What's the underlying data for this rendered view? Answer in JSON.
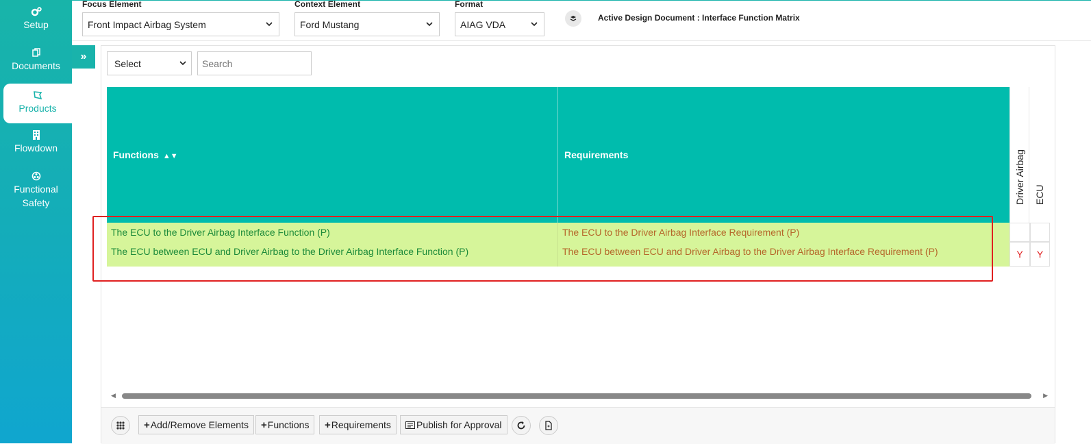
{
  "sidebar": {
    "items": [
      {
        "label": "Setup",
        "icon": "gears-icon"
      },
      {
        "label": "Documents",
        "icon": "copy-icon"
      },
      {
        "label": "Products",
        "icon": "product-icon",
        "active": true
      },
      {
        "label": "Flowdown",
        "icon": "building-icon"
      },
      {
        "label": "Functional Safety",
        "icon": "biohazard-icon"
      }
    ]
  },
  "header": {
    "focus_label": "Focus Element",
    "focus_value": "Front Impact Airbag System",
    "context_label": "Context Element",
    "context_value": "Ford Mustang",
    "format_label": "Format",
    "format_value": "AIAG VDA",
    "active_doc": "Active Design Document : Interface Function Matrix"
  },
  "filter": {
    "select_value": "Select",
    "search_placeholder": "Search"
  },
  "table": {
    "columns": {
      "functions": "Functions",
      "requirements": "Requirements"
    },
    "matrix_columns": [
      "Driver Airbag",
      "ECU"
    ],
    "rows": [
      {
        "function": "The ECU to the Driver Airbag Interface Function (P)",
        "requirement": "The ECU to the Driver Airbag Interface Requirement (P)",
        "marks": [
          "",
          ""
        ]
      },
      {
        "function": "The ECU between ECU and Driver Airbag to the Driver Airbag Interface Function (P)",
        "requirement": "The ECU between ECU and Driver Airbag to the Driver Airbag Interface Requirement (P)",
        "marks": [
          "Y",
          "Y"
        ]
      }
    ]
  },
  "toolbar": {
    "add_remove": "Add/Remove Elements",
    "functions": "Functions",
    "requirements": "Requirements",
    "publish": "Publish for Approval"
  },
  "colors": {
    "accent": "#00bcad",
    "row_bg": "#d6f59a",
    "mark": "#e02020"
  }
}
